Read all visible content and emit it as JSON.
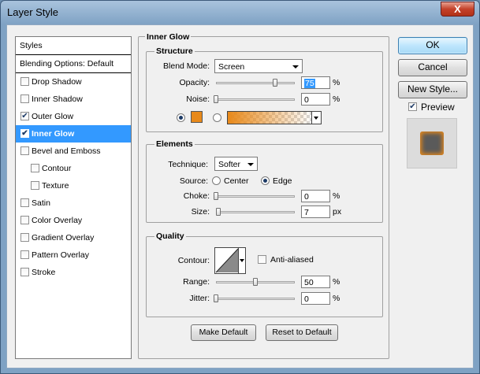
{
  "window": {
    "title": "Layer Style",
    "close_glyph": "X"
  },
  "styles_list": {
    "header": "Styles",
    "blending_options": "Blending Options: Default",
    "items": [
      {
        "label": "Drop Shadow",
        "checked": false,
        "selected": false,
        "sub": false
      },
      {
        "label": "Inner Shadow",
        "checked": false,
        "selected": false,
        "sub": false
      },
      {
        "label": "Outer Glow",
        "checked": true,
        "selected": false,
        "sub": false
      },
      {
        "label": "Inner Glow",
        "checked": true,
        "selected": true,
        "sub": false
      },
      {
        "label": "Bevel and Emboss",
        "checked": false,
        "selected": false,
        "sub": false
      },
      {
        "label": "Contour",
        "checked": false,
        "selected": false,
        "sub": true
      },
      {
        "label": "Texture",
        "checked": false,
        "selected": false,
        "sub": true
      },
      {
        "label": "Satin",
        "checked": false,
        "selected": false,
        "sub": false
      },
      {
        "label": "Color Overlay",
        "checked": false,
        "selected": false,
        "sub": false
      },
      {
        "label": "Gradient Overlay",
        "checked": false,
        "selected": false,
        "sub": false
      },
      {
        "label": "Pattern Overlay",
        "checked": false,
        "selected": false,
        "sub": false
      },
      {
        "label": "Stroke",
        "checked": false,
        "selected": false,
        "sub": false
      }
    ]
  },
  "panel": {
    "title": "Inner Glow",
    "structure": {
      "title": "Structure",
      "blend_mode_label": "Blend Mode:",
      "blend_mode_value": "Screen",
      "opacity_label": "Opacity:",
      "opacity_value": "75",
      "opacity_fraction": 0.75,
      "noise_label": "Noise:",
      "noise_value": "0",
      "noise_fraction": 0,
      "percent": "%",
      "glow_color": "#e8891a",
      "color_selected": true
    },
    "elements": {
      "title": "Elements",
      "technique_label": "Technique:",
      "technique_value": "Softer",
      "source_label": "Source:",
      "source_center": "Center",
      "source_edge": "Edge",
      "source_selected": "Edge",
      "choke_label": "Choke:",
      "choke_value": "0",
      "choke_fraction": 0,
      "size_label": "Size:",
      "size_value": "7",
      "size_fraction": 0.03,
      "percent": "%",
      "px": "px"
    },
    "quality": {
      "title": "Quality",
      "contour_label": "Contour:",
      "antialiased_label": "Anti-aliased",
      "antialiased_checked": false,
      "range_label": "Range:",
      "range_value": "50",
      "range_fraction": 0.5,
      "jitter_label": "Jitter:",
      "jitter_value": "0",
      "jitter_fraction": 0,
      "percent": "%"
    },
    "make_default": "Make Default",
    "reset_default": "Reset to Default"
  },
  "actions": {
    "ok": "OK",
    "cancel": "Cancel",
    "new_style": "New Style...",
    "preview_label": "Preview",
    "preview_checked": true
  },
  "colors": {
    "selection": "#3399ff",
    "glow": "#e8891a",
    "preview_swatch": "#5a5a5a"
  },
  "icons": {
    "checkmark": "checkmark-icon",
    "dropdown": "chevron-down-icon",
    "close": "close-icon"
  }
}
